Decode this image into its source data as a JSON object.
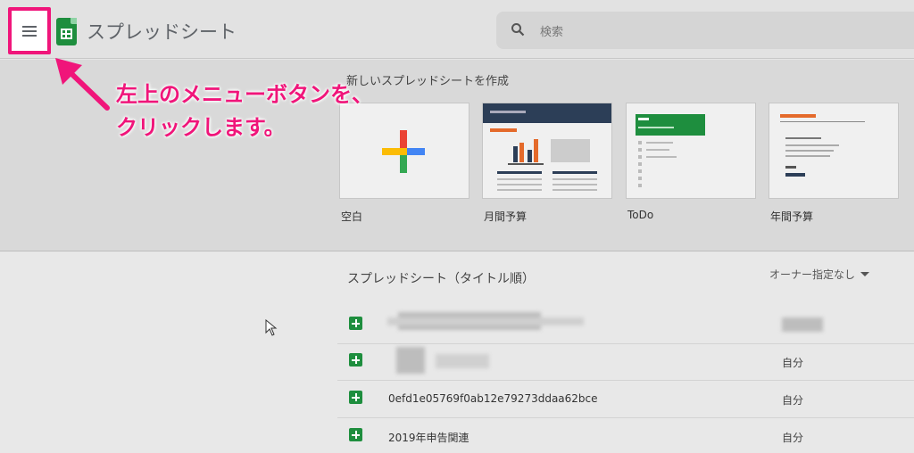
{
  "header": {
    "menu_icon": "hamburger-menu-icon",
    "app_icon": "sheets-icon",
    "app_title": "スプレッドシート",
    "search_icon": "search-icon",
    "search_placeholder": "検索"
  },
  "templates": {
    "heading": "新しいスプレッドシートを作成",
    "items": [
      {
        "label": "空白"
      },
      {
        "label": "月間予算"
      },
      {
        "label": "ToDo"
      },
      {
        "label": "年間予算"
      }
    ]
  },
  "callout": {
    "line1": "左上のメニューボタンを、",
    "line2": "クリックします。",
    "color": "#f0157a"
  },
  "files": {
    "heading": "スプレッドシート（タイトル順）",
    "owner_filter": "オーナー指定なし",
    "rows": [
      {
        "name": "",
        "owner": ""
      },
      {
        "name": "",
        "owner": "自分"
      },
      {
        "name": "0efd1e05769f0ab12e79273ddaa62bce",
        "owner": "自分"
      },
      {
        "name": "2019年申告関連",
        "owner": "自分"
      }
    ]
  },
  "colors": {
    "accent": "#f0157a",
    "sheets_green": "#1e8e3e"
  }
}
